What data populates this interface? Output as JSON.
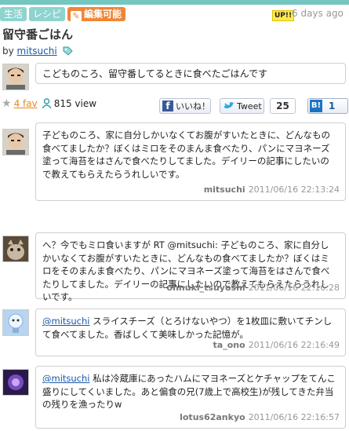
{
  "tags": [
    "生活",
    "レシピ",
    "編集可能"
  ],
  "up_badge": "UP!!",
  "updated_ago": "6 days ago",
  "title": "留守番ごはん",
  "byline": {
    "prefix": "by",
    "user": "mitsuchi"
  },
  "description": "こどものころ、留守番してるときに食べたごはんです",
  "stats": {
    "fav": "4 fav",
    "views": "815 view"
  },
  "share": {
    "facebook_label": "いいね！",
    "tweet_label": "Tweet",
    "tweet_count": "25",
    "hatena_count": "1"
  },
  "comments": [
    {
      "mention": "",
      "body": "子どものころ、家に自分しかいなくてお腹がすいたときに、どんなもの食べてましたか？ぼくはミロをそのまんま食べたり、パンにマヨネーズ塗って海苔をはさんで食べたりしてました。デイリーの記事にしたいので教えてもらえたらうれしいです。",
      "user": "mitsuchi",
      "time": "2011/06/16 22:13:24"
    },
    {
      "mention": "",
      "body": "へ？今でもミロ食いますが RT @mitsuchi: 子どものころ、家に自分しかいなくてお腹がすいたときに、どんなもの食べてましたか？ぼくはミロをそのまんま食べたり、パンにマヨネーズ塗って海苔をはさんで食べたりしてました。デイリーの記事にしたいので教えてもらえたらうれしいです。",
      "user": "ohnuki_tsuyoshi",
      "time": "2011/06/16 22:16:28"
    },
    {
      "mention": "@mitsuchi",
      "body": " スライスチーズ（とろけないやつ）を1枚皿に敷いてチンして食べてました。香ばしくて美味しかった記憶が。",
      "user": "ta_ono",
      "time": "2011/06/16 22:16:49"
    },
    {
      "mention": "@mitsuchi",
      "body": " 私は冷蔵庫にあったハムにマヨネーズとケチャップをてんこ盛りにしてくいました。あと偏食の兄(7歳上で高校生)が残してきた弁当の残りを漁ったりw",
      "user": "lotus62ankyo",
      "time": "2011/06/16 22:16:57"
    }
  ]
}
